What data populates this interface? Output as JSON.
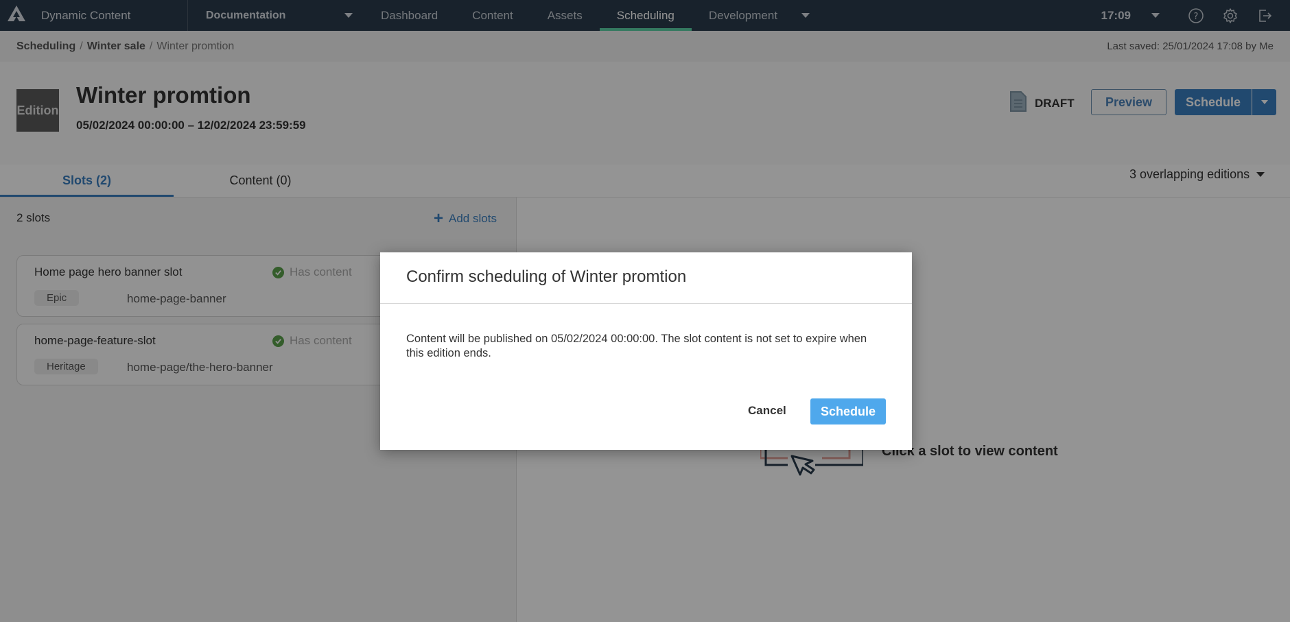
{
  "topnav": {
    "app_name": "Dynamic Content",
    "hub": "Documentation",
    "tabs": [
      {
        "label": "Dashboard",
        "active": false
      },
      {
        "label": "Content",
        "active": false
      },
      {
        "label": "Assets",
        "active": false
      },
      {
        "label": "Scheduling",
        "active": true
      },
      {
        "label": "Development",
        "active": false
      }
    ],
    "clock": "17:09",
    "icons": [
      "help-icon",
      "settings-icon",
      "logout-icon"
    ]
  },
  "breadcrumb": {
    "items": [
      "Scheduling",
      "Winter sale",
      "Winter promtion"
    ],
    "separator": "/",
    "last_saved": "Last saved: 25/01/2024 17:08 by Me"
  },
  "header": {
    "badge": "Edition",
    "title": "Winter promtion",
    "date_range": "05/02/2024 00:00:00  –  12/02/2024 23:59:59",
    "status": "DRAFT",
    "preview_label": "Preview",
    "schedule_label": "Schedule"
  },
  "tabs": [
    {
      "label": "Slots (2)",
      "active": true
    },
    {
      "label": "Content (0)",
      "active": false
    }
  ],
  "overlapping": "3 overlapping editions",
  "slots_panel": {
    "count_label": "2 slots",
    "add_label": "Add slots",
    "slots": [
      {
        "name": "Home page hero banner slot",
        "status": "Has content",
        "tag": "Epic",
        "path": "home-page-banner"
      },
      {
        "name": "home-page-feature-slot",
        "status": "Has content",
        "tag": "Heritage",
        "path": "home-page/the-hero-banner"
      }
    ]
  },
  "empty_state": {
    "text": "Click a slot to view content"
  },
  "modal": {
    "title": "Confirm scheduling of Winter promtion",
    "body": "Content will be published on 05/02/2024 00:00:00. The slot content is not set to expire when this edition ends.",
    "cancel_label": "Cancel",
    "confirm_label": "Schedule"
  },
  "colors": {
    "nav_bg": "#2a3b4c",
    "active_tab_accent": "#5ad1a6",
    "primary": "#3a7fc0",
    "modal_button": "#4fa8ec",
    "success": "#5aa04a"
  }
}
